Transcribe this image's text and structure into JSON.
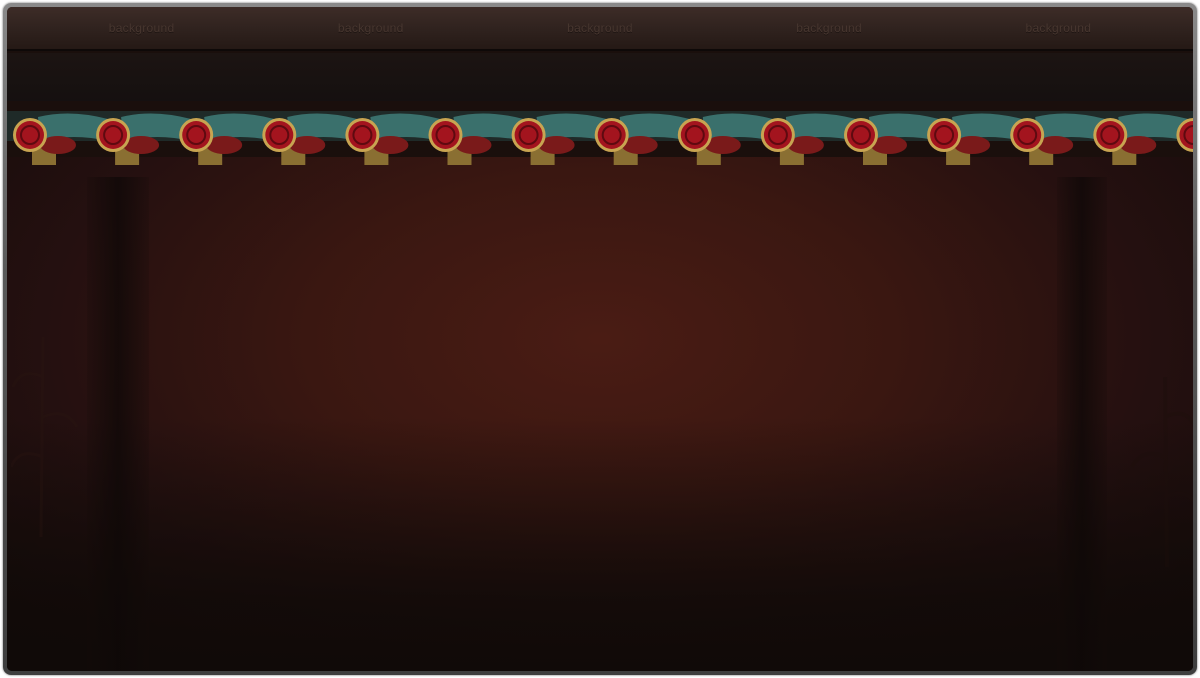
{
  "top_bar": {
    "labels": [
      "background",
      "background",
      "background",
      "background",
      "background"
    ]
  },
  "eave": {
    "tile_count": 15
  },
  "colors": {
    "wall": "#3a1711",
    "beam": "#2f221e",
    "tile_teal": "#3f7d78",
    "tile_red": "#a3141e",
    "bracket_gold": "#8a6f32"
  }
}
